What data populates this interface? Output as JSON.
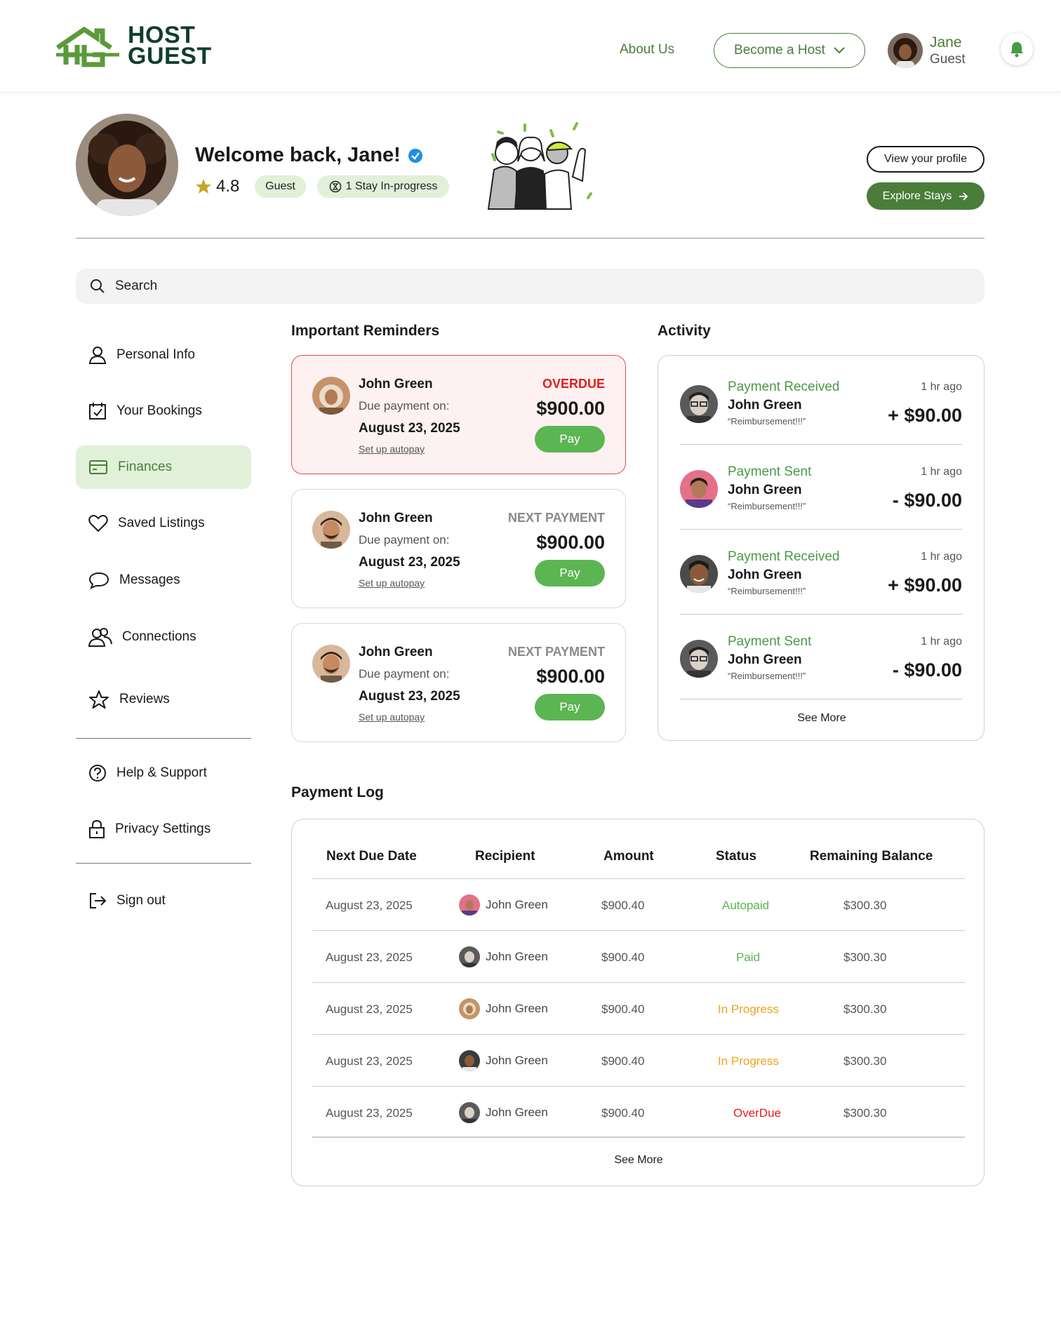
{
  "brand": {
    "line1": "HOST",
    "line2": "GUEST",
    "primary": "#4a7d3a",
    "dark": "#0f3d2e"
  },
  "header": {
    "about": "About Us",
    "become_host": "Become a Host",
    "user_name": "Jane",
    "user_role": "Guest"
  },
  "profile": {
    "welcome": "Welcome back, Jane!",
    "rating": "4.8",
    "role_badge": "Guest",
    "stay_badge": "1 Stay In-progress",
    "view_profile": "View your profile",
    "explore": "Explore Stays"
  },
  "search": {
    "placeholder": "Search"
  },
  "sidebar": {
    "items": [
      {
        "label": "Personal Info",
        "icon": "person-icon"
      },
      {
        "label": "Your Bookings",
        "icon": "calendar-check-icon"
      },
      {
        "label": "Finances",
        "icon": "card-icon",
        "active": true
      },
      {
        "label": "Saved Listings",
        "icon": "heart-icon"
      },
      {
        "label": "Messages",
        "icon": "chat-bubble-icon"
      },
      {
        "label": "Connections",
        "icon": "people-icon"
      },
      {
        "label": "Reviews",
        "icon": "star-icon"
      }
    ],
    "help": "Help & Support",
    "privacy": "Privacy Settings",
    "signout": "Sign out"
  },
  "reminders": {
    "title": "Important Reminders",
    "items": [
      {
        "name": "John Green",
        "due_label": "Due payment on:",
        "date": "August 23, 2025",
        "autopay": "Set up autopay",
        "status": "OVERDUE",
        "amount": "$900.00",
        "pay": "Pay"
      },
      {
        "name": "John Green",
        "due_label": "Due payment on:",
        "date": "August 23, 2025",
        "autopay": "Set up autopay",
        "status": "NEXT PAYMENT",
        "amount": "$900.00",
        "pay": "Pay"
      },
      {
        "name": "John Green",
        "due_label": "Due payment on:",
        "date": "August 23, 2025",
        "autopay": "Set up autopay",
        "status": "NEXT PAYMENT",
        "amount": "$900.00",
        "pay": "Pay"
      }
    ]
  },
  "activity": {
    "title": "Activity",
    "items": [
      {
        "type": "Payment Received",
        "name": "John Green",
        "note": "“Reimbursement!!!”",
        "time": "1 hr ago",
        "amount": "+ $90.00"
      },
      {
        "type": "Payment Sent",
        "name": "John Green",
        "note": "“Reimbursement!!!”",
        "time": "1 hr ago",
        "amount": "- $90.00"
      },
      {
        "type": "Payment Received",
        "name": "John Green",
        "note": "“Reimbursement!!!”",
        "time": "1 hr ago",
        "amount": "+ $90.00"
      },
      {
        "type": "Payment Sent",
        "name": "John Green",
        "note": "“Reimbursement!!!”",
        "time": "1 hr ago",
        "amount": "- $90.00"
      }
    ],
    "see_more": "See More"
  },
  "payment_log": {
    "title": "Payment Log",
    "columns": [
      "Next Due Date",
      "Recipient",
      "Amount",
      "Status",
      "Remaining Balance"
    ],
    "rows": [
      {
        "date": "August 23, 2025",
        "recipient": "John Green",
        "amount": "$900.40",
        "status": "Autopaid",
        "balance": "$300.30"
      },
      {
        "date": "August 23, 2025",
        "recipient": "John Green",
        "amount": "$900.40",
        "status": "Paid",
        "balance": "$300.30"
      },
      {
        "date": "August 23, 2025",
        "recipient": "John Green",
        "amount": "$900.40",
        "status": "In Progress",
        "balance": "$300.30"
      },
      {
        "date": "August 23, 2025",
        "recipient": "John Green",
        "amount": "$900.40",
        "status": "In Progress",
        "balance": "$300.30"
      },
      {
        "date": "August 23, 2025",
        "recipient": "John Green",
        "amount": "$900.40",
        "status": "OverDue",
        "balance": "$300.30"
      }
    ],
    "see_more": "See More"
  },
  "status_colors": {
    "success": "#5cb553",
    "warning": "#f0a31d",
    "danger": "#e51b1b"
  }
}
